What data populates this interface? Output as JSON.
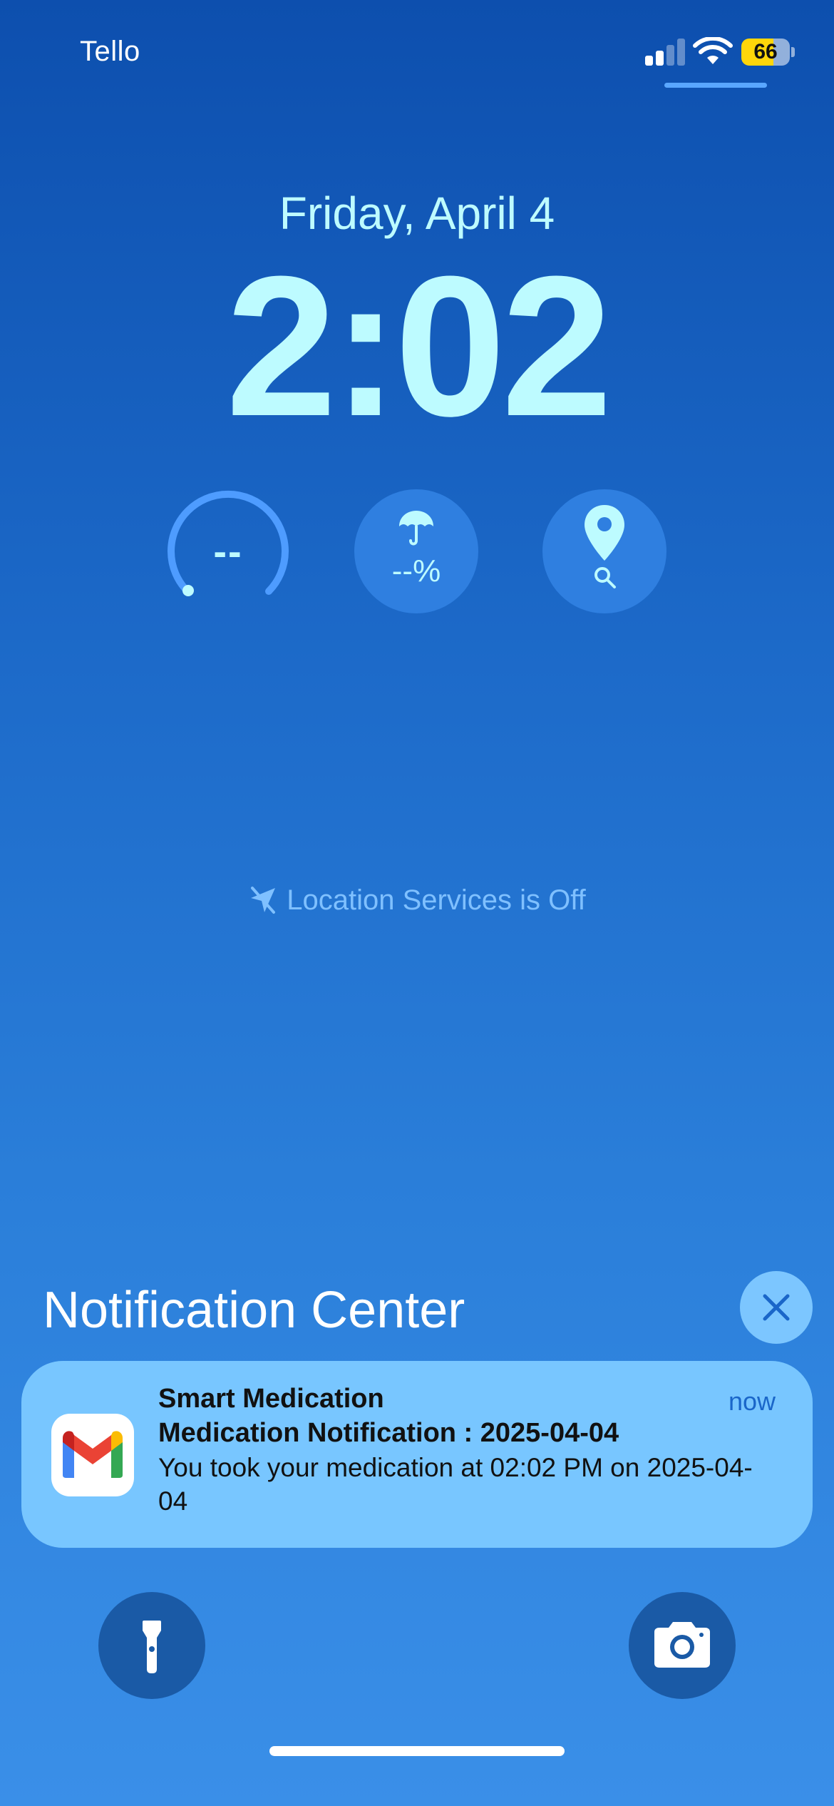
{
  "status_bar": {
    "carrier": "Tello",
    "battery_percent": "66",
    "signal_bars_active": 2,
    "signal_bars_total": 4
  },
  "lock_screen": {
    "date": "Friday, April 4",
    "time": "2:02"
  },
  "widgets": {
    "gauge_value": "--",
    "rain_chance": "--%",
    "rain_icon": "umbrella-icon",
    "location_icon": "map-pin-icon",
    "search_icon": "magnifying-glass-icon"
  },
  "location_notice": {
    "icon": "location-off-icon",
    "text": "Location Services is Off"
  },
  "notification_center": {
    "title": "Notification Center",
    "close_icon": "close-icon",
    "notification": {
      "app_name": "Smart Medication",
      "app_icon": "gmail-icon",
      "time": "now",
      "title": "Medication Notification : 2025-04-04",
      "body": "You took your medication at 02:02 PM on 2025-04-04"
    }
  },
  "controls": {
    "left_icon": "flashlight-icon",
    "right_icon": "camera-icon"
  },
  "colors": {
    "accent_text": "#bdfbff",
    "notification_bg": "#78c6ff",
    "battery": "#ffd60a",
    "control_bg": "#1a5aa6"
  }
}
